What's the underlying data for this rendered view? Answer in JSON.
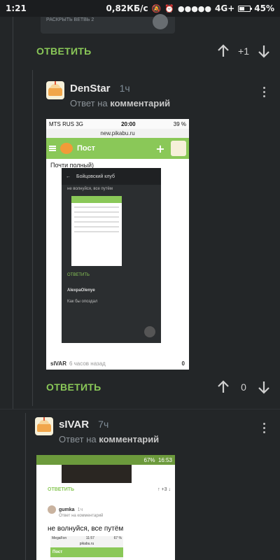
{
  "status_bar": {
    "time": "1:21",
    "speed": "0,82КБ/с",
    "network": "4G+",
    "battery": "45%"
  },
  "top_thread": {
    "collapsed_label": "РАСКРЫТЬ ВЕТВЬ 2",
    "reply_label": "ОТВЕТИТЬ",
    "rating": "+1"
  },
  "comment1": {
    "username": "DenStar",
    "ago": "1ч",
    "reply_prefix": "Ответ на",
    "reply_target": "комментарий",
    "shot": {
      "carrier": "MTS RUS",
      "net": "3G",
      "time": "20:00",
      "battery": "39 %",
      "url": "new.pikabu.ru",
      "section": "Пост",
      "text": "Почти полный)",
      "inner_title": "Бойцовский клуб",
      "inner_note": "не волнуйся, все путём",
      "inner_reply": "ОТВЕТИТЬ",
      "inner_user": "AlexpaOlenye",
      "inner_comment": "Как бы опоздал",
      "footer_user": "sIVAR",
      "footer_ago": "6 часов назад",
      "footer_rating": "0"
    },
    "reply_label": "ОТВЕТИТЬ",
    "rating": "0"
  },
  "comment2": {
    "username": "sIVAR",
    "ago": "7ч",
    "reply_prefix": "Ответ на",
    "reply_target": "комментарий",
    "shot": {
      "battery": "67%",
      "time": "16:53",
      "reply_label": "ОТВЕТИТЬ",
      "rating": "+3",
      "user": "gumka",
      "ago": "1ч",
      "sub": "Ответ на комментарий",
      "text": "не волнуйся, все путём",
      "phone_carrier": "MegaFon",
      "phone_time": "11:57",
      "phone_battery": "67 %",
      "phone_url": "pikabu.ru",
      "phone_section": "Пост"
    }
  },
  "colors": {
    "background": "#232628",
    "accent": "#8ac858"
  }
}
